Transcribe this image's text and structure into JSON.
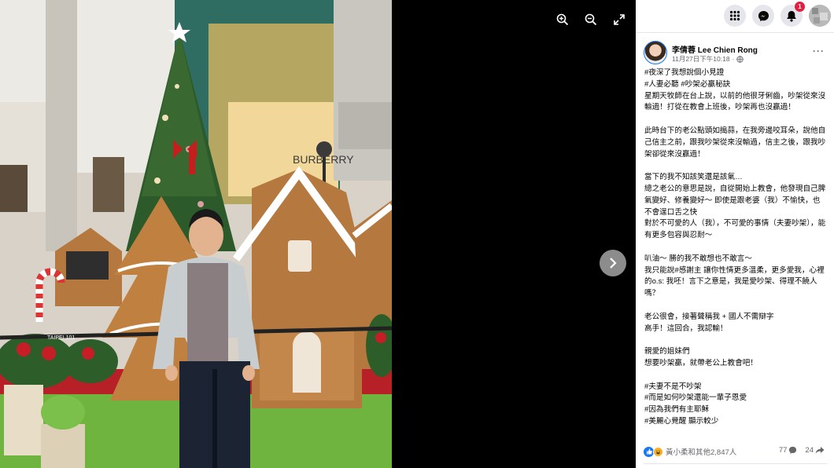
{
  "viewer": {
    "photo_alt": "",
    "tools": [
      {
        "name": "zoom-in-icon"
      },
      {
        "name": "zoom-out-icon"
      },
      {
        "name": "fullscreen-icon"
      }
    ],
    "next_icon": "chevron-right-icon",
    "sign_text": "BURBERRY",
    "tower_label": "TAIPEI 101"
  },
  "topbar": {
    "icons": [
      "menu-grid-icon",
      "messenger-icon",
      "bell-icon"
    ],
    "notification_count": "1"
  },
  "post": {
    "author": "李倩蓉 Lee Chien Rong",
    "timestamp": "11月27日下午10:18",
    "privacy_dot": "·",
    "more": "···",
    "body": "#夜深了我想說個小見證\n#人妻必聽 #吵架必贏秘訣\n星期天牧師在台上說，以前的他很牙俐齒，吵架從來沒輸過！打從在教會上班後，吵架再也沒贏過！\n\n此時台下的老公點頭如搗蒜，在我旁邊咬耳朵，說他自己信主之前，跟我吵架從來沒輸過，信主之後，跟我吵架卻從來沒贏過！\n\n當下的我不知該笑還是該氣…\n總之老公的意思是說，自從開始上教會，他發現自己脾氣變好、修養變好～ 即使是跟老婆（我）不愉快，也不會逞口舌之快\n對於不可愛的人（我），不可愛的事情（夫妻吵架），能有更多包容與忍耐～\n\n叭油～ 勝的我不敢想也不敢言～\n我只能說#感謝主 讓你性情更多溫柔，更多愛我，心裡的o.s: 我呸！言下之意是，我是愛吵架、得理不饒人嗎？\n\n老公很會，接著聲稱我 + 國人不需辯字\n高手！這回合，我認輸！\n\n親愛的姐妹們\n想要吵架贏，就帶老公上教會吧！\n\n#夫妻不是不吵架\n#而是如何吵架還能一輩子恩愛\n#因為我們有主耶穌\n#美麗心覺醒 顯示較少"
  },
  "footer": {
    "reactions_text": "黃小柔和其他2,847人",
    "comments": "77",
    "shares": "24"
  },
  "colors": {
    "accent": "#1877f2",
    "badge": "#e41e3f",
    "text": "#050505",
    "muted": "#65676b"
  }
}
